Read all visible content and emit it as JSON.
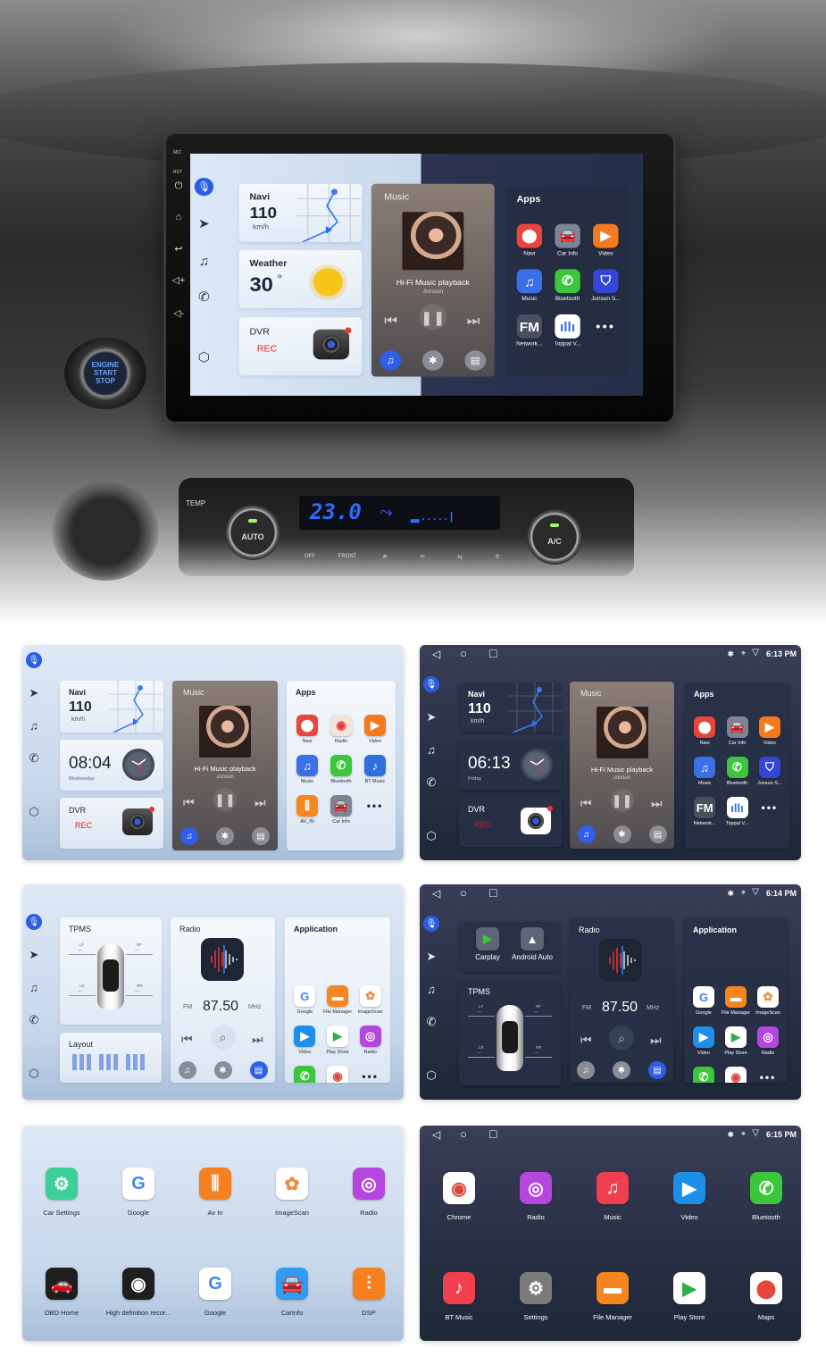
{
  "hero": {
    "bezel_labels": [
      "MIC",
      "RST"
    ],
    "engine_button": [
      "ENGINE",
      "START",
      "STOP"
    ],
    "climate": {
      "temp_label": "TEMP",
      "display_temp": "23.0",
      "auto": "AUTO",
      "ac": "A/C",
      "buttons": [
        "OFF",
        "FRONT"
      ]
    },
    "screen": {
      "navi": {
        "title": "Navi",
        "speed": "110",
        "unit": "km/h"
      },
      "weather": {
        "title": "Weather",
        "temp": "30",
        "unit": "°"
      },
      "dvr": {
        "title": "DVR",
        "status": "REC"
      },
      "music": {
        "title": "Music",
        "track": "Hi-Fi Music playback",
        "artist": "Junsun"
      },
      "apps": {
        "title": "Apps",
        "items": [
          {
            "label": "Navi",
            "icon": "map-pin",
            "color": "#e8453c"
          },
          {
            "label": "Car Info",
            "icon": "car",
            "color": "#7d8594"
          },
          {
            "label": "Video",
            "icon": "play",
            "color": "#f57a1f"
          },
          {
            "label": "Music",
            "icon": "music-note",
            "color": "#3a6fe8"
          },
          {
            "label": "Bluetooth",
            "icon": "phone",
            "color": "#3cc63c"
          },
          {
            "label": "Junsun S...",
            "icon": "shield",
            "color": "#3346d8"
          },
          {
            "label": "Network...",
            "icon": "fm",
            "color": "#4a4f5e"
          },
          {
            "label": "Toppal V...",
            "icon": "waveform",
            "color": "#ffffff"
          }
        ],
        "more": "•••"
      }
    }
  },
  "panels": {
    "p1": {
      "navi": {
        "title": "Navi",
        "speed": "110",
        "unit": "km/h"
      },
      "clock": {
        "time": "08:04",
        "day": "Wednesday"
      },
      "dvr": {
        "title": "DVR",
        "status": "REC"
      },
      "music": {
        "title": "Music",
        "track": "Hi-Fi Music playback",
        "artist": "Junsun"
      },
      "apps": {
        "title": "Apps",
        "items": [
          {
            "label": "Navi",
            "icon": "map-pin",
            "color": "#e8453c"
          },
          {
            "label": "Radio",
            "icon": "radio-tower",
            "color": "#f0e4dc"
          },
          {
            "label": "Video",
            "icon": "play",
            "color": "#f57a1f"
          },
          {
            "label": "Music",
            "icon": "music-note",
            "color": "#3a6fe8"
          },
          {
            "label": "Bluetooth",
            "icon": "phone",
            "color": "#3cc63c"
          },
          {
            "label": "BT Music",
            "icon": "bt-music",
            "color": "#2f6fe0"
          },
          {
            "label": "AV_IN",
            "icon": "av-in",
            "color": "#f5871f"
          },
          {
            "label": "Car Info",
            "icon": "car",
            "color": "#7d8594"
          }
        ],
        "more": "•••"
      }
    },
    "p2": {
      "status": {
        "time": "6:13 PM"
      },
      "navi": {
        "title": "Navi",
        "speed": "110",
        "unit": "km/h"
      },
      "clock": {
        "time": "06:13",
        "day": "Friday"
      },
      "dvr": {
        "title": "DVR",
        "status": "REC"
      },
      "music": {
        "title": "Music",
        "track": "Hi-Fi Music playback",
        "artist": "Junsun"
      },
      "apps": {
        "title": "Apps",
        "items": [
          {
            "label": "Navi",
            "icon": "map-pin",
            "color": "#e8453c"
          },
          {
            "label": "Car Info",
            "icon": "car",
            "color": "#7d8594"
          },
          {
            "label": "Video",
            "icon": "play",
            "color": "#f57a1f"
          },
          {
            "label": "Music",
            "icon": "music-note",
            "color": "#3a6fe8"
          },
          {
            "label": "Bluetooth",
            "icon": "phone",
            "color": "#3cc63c"
          },
          {
            "label": "Junsun S...",
            "icon": "shield",
            "color": "#3346d8"
          },
          {
            "label": "Network...",
            "icon": "fm",
            "color": "#4a4f5e"
          },
          {
            "label": "Toppal V...",
            "icon": "waveform",
            "color": "#ffffff"
          }
        ],
        "more": "•••"
      }
    },
    "p3": {
      "tpms": {
        "title": "TPMS",
        "lf": "LF",
        "rf": "RF",
        "lr": "LR",
        "rr": "RR",
        "value": "---"
      },
      "layout": {
        "title": "Layout"
      },
      "radio": {
        "title": "Radio",
        "band": "FM",
        "freq": "87.50",
        "unit": "MHz"
      },
      "application": {
        "title": "Application",
        "items": [
          {
            "label": "Google",
            "icon": "google",
            "color": "#ffffff"
          },
          {
            "label": "File Manager",
            "icon": "folder",
            "color": "#f5861f"
          },
          {
            "label": "ImageScan",
            "icon": "photos",
            "color": "#ffffff"
          },
          {
            "label": "Video",
            "icon": "video-camera",
            "color": "#1e8fe8"
          },
          {
            "label": "Play Store",
            "icon": "play-store",
            "color": "#ffffff"
          },
          {
            "label": "Radio",
            "icon": "podcast",
            "color": "#b546e0"
          },
          {
            "label": "Bluetooth",
            "icon": "phone",
            "color": "#3cc63c"
          },
          {
            "label": "Chrome",
            "icon": "chrome",
            "color": "#ffffff"
          }
        ],
        "more": "•••"
      }
    },
    "p4": {
      "status": {
        "time": "6:14 PM"
      },
      "carplay": {
        "carplay": "Carplay",
        "android_auto": "Android Auto"
      },
      "tpms": {
        "title": "TPMS",
        "lf": "LF",
        "rf": "RF",
        "lr": "LR",
        "rr": "RR",
        "value": "---"
      },
      "radio": {
        "title": "Radio",
        "band": "FM",
        "freq": "87.50",
        "unit": "MHz"
      },
      "application": {
        "title": "Application",
        "items": [
          {
            "label": "Google",
            "icon": "google",
            "color": "#ffffff"
          },
          {
            "label": "File Manager",
            "icon": "folder",
            "color": "#f5861f"
          },
          {
            "label": "ImageScan",
            "icon": "photos",
            "color": "#ffffff"
          },
          {
            "label": "Video",
            "icon": "video-camera",
            "color": "#1e8fe8"
          },
          {
            "label": "Play Store",
            "icon": "play-store",
            "color": "#ffffff"
          },
          {
            "label": "Radio",
            "icon": "podcast",
            "color": "#b546e0"
          },
          {
            "label": "Bluetooth",
            "icon": "phone",
            "color": "#3cc63c"
          },
          {
            "label": "Chrome",
            "icon": "chrome",
            "color": "#ffffff"
          }
        ],
        "more": "•••"
      }
    },
    "p5": {
      "items": [
        {
          "label": "Car Settings",
          "icon": "car-settings",
          "color": "#3ccf9a"
        },
        {
          "label": "Google",
          "icon": "google",
          "color": "#ffffff"
        },
        {
          "label": "Av In",
          "icon": "av-in",
          "color": "#f5801f"
        },
        {
          "label": "ImageScan",
          "icon": "photos",
          "color": "#ffffff"
        },
        {
          "label": "Radio",
          "icon": "podcast",
          "color": "#b546e0"
        },
        {
          "label": "OBD Home",
          "icon": "obd-car",
          "color": "#1e1e1e"
        },
        {
          "label": "High definition recor...",
          "icon": "camera-lens",
          "color": "#1e1e1e"
        },
        {
          "label": "Google",
          "icon": "google",
          "color": "#ffffff"
        },
        {
          "label": "CarInfo",
          "icon": "car",
          "color": "#2f9cf0"
        },
        {
          "label": "DSP",
          "icon": "equalizer",
          "color": "#f5801f"
        }
      ]
    },
    "p6": {
      "status": {
        "time": "6:15 PM"
      },
      "items": [
        {
          "label": "Chrome",
          "icon": "chrome",
          "color": "#ffffff"
        },
        {
          "label": "Radio",
          "icon": "podcast",
          "color": "#b546e0"
        },
        {
          "label": "Music",
          "icon": "music-note",
          "color": "#f0404f"
        },
        {
          "label": "Video",
          "icon": "video-camera",
          "color": "#1e8fe8"
        },
        {
          "label": "Bluetooth",
          "icon": "phone",
          "color": "#3cc63c"
        },
        {
          "label": "BT Music",
          "icon": "bt-music",
          "color": "#f0404f"
        },
        {
          "label": "Settings",
          "icon": "gear",
          "color": "#7b7b7b"
        },
        {
          "label": "File Manager",
          "icon": "folder",
          "color": "#f5861f"
        },
        {
          "label": "Play Store",
          "icon": "play-store",
          "color": "#ffffff"
        },
        {
          "label": "Maps",
          "icon": "maps",
          "color": "#ffffff"
        }
      ]
    }
  }
}
